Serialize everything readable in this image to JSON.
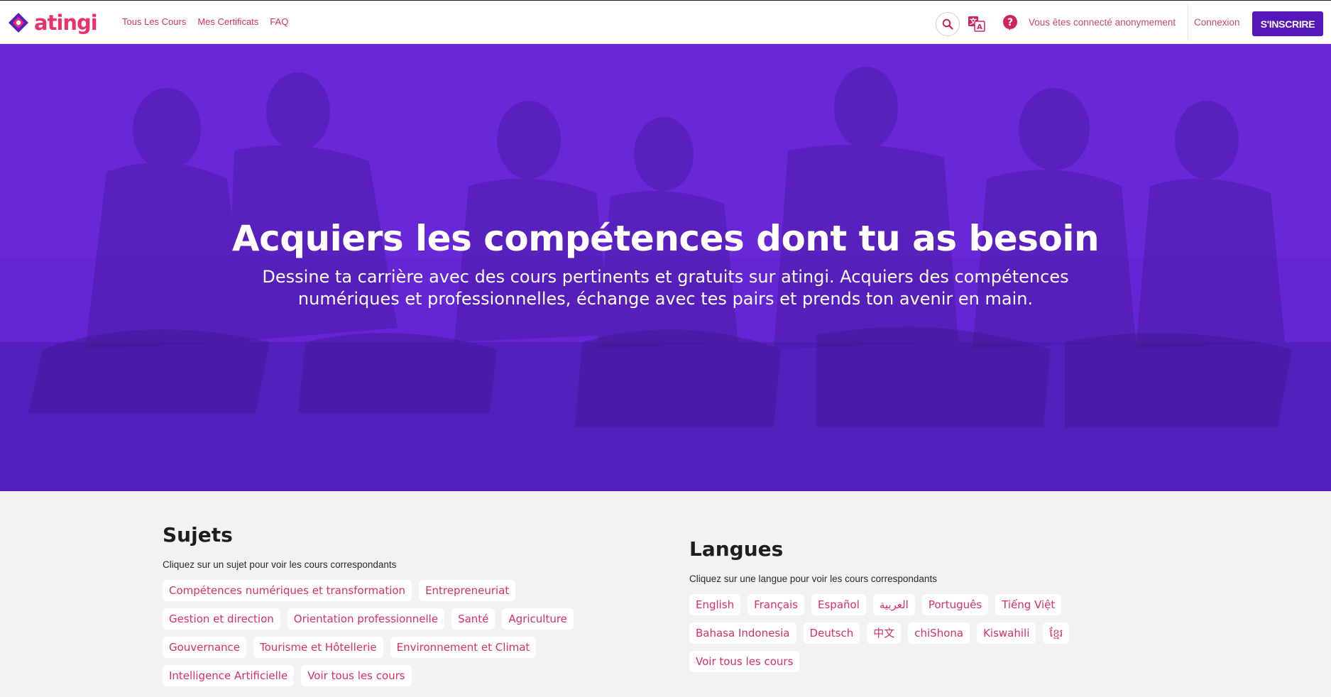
{
  "header": {
    "logo_text": "atingi",
    "nav": [
      "Tous Les Cours",
      "Mes Certificats",
      "FAQ"
    ],
    "icons": [
      "search-icon",
      "translate-icon",
      "help-icon"
    ],
    "anon_status": "Vous êtes connecté anonymement",
    "login_label": "Connexion",
    "signup_label": "S'INSCRIRE"
  },
  "hero": {
    "title": "Acquiers les compétences dont tu as besoin",
    "subtitle": "Dessine ta carrière avec des cours pertinents et gratuits sur atingi. Acquiers des compétences numériques et professionnelles, échange avec tes pairs et prends ton avenir en main."
  },
  "subjects": {
    "title": "Sujets",
    "subtitle": "Cliquez sur un sujet pour voir les cours correspondants",
    "items": [
      "Compétences numériques et transformation",
      "Entrepreneuriat",
      "Gestion et direction",
      "Orientation professionnelle",
      "Santé",
      "Agriculture",
      "Gouvernance",
      "Tourisme et Hôtellerie",
      "Environnement et Climat",
      "Intelligence Artificielle",
      "Voir tous les cours"
    ]
  },
  "languages": {
    "title": "Langues",
    "subtitle": "Cliquez sur une langue pour voir les cours correspondants",
    "items": [
      "English",
      "Français",
      "Español",
      "العربية",
      "Português",
      "Tiếng Việt",
      "Bahasa Indonesia",
      "Deutsch",
      "中文",
      "chiShona",
      "Kiswahili",
      "ខ្មែរ",
      "Voir tous les cours"
    ]
  },
  "colors": {
    "brand": "#e8336a",
    "link": "#d63063",
    "button": "#5517b7",
    "hero_overlay": "#6526d2",
    "page_bg": "#f2f2f2"
  }
}
